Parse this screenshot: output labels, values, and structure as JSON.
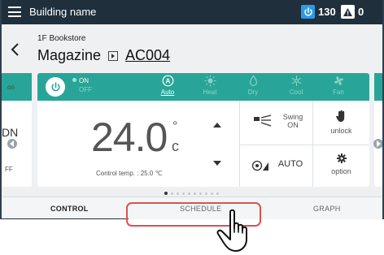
{
  "topbar": {
    "building_name": "Building name",
    "on_count": "130",
    "alert_count": "0"
  },
  "header": {
    "location": "1F Bookstore",
    "group": "Magazine",
    "unit": "AC004"
  },
  "left_card": {
    "t1": "on",
    "t2": "DN",
    "t3": "FF"
  },
  "control": {
    "on_label": "ON",
    "off_label": "OFF",
    "modes": [
      {
        "label": "Auto",
        "icon": "auto-icon"
      },
      {
        "label": "Heat",
        "icon": "sun-icon"
      },
      {
        "label": "Dry",
        "icon": "drop-icon"
      },
      {
        "label": "Cool",
        "icon": "snowflake-icon"
      },
      {
        "label": "Fan",
        "icon": "fan-icon"
      }
    ],
    "active_mode": "Auto",
    "set_temp": "24.0",
    "degree": "°",
    "unit_c": "c",
    "control_temp": "Control temp. : 25.0 ℃",
    "swing_label": "Swing",
    "swing_value": "ON",
    "lock_label": "unlock",
    "fan_value": "AUTO",
    "option_label": "option"
  },
  "pager": {
    "total": 10,
    "active": 1
  },
  "tabs": {
    "control": "CONTROL",
    "schedule": "SCHEDULE",
    "graph": "GRAPH"
  },
  "colors": {
    "topbar": "#1f2f3c",
    "teal": "#28a598",
    "power_blue": "#2b9be6",
    "highlight_red": "#d9534f"
  }
}
